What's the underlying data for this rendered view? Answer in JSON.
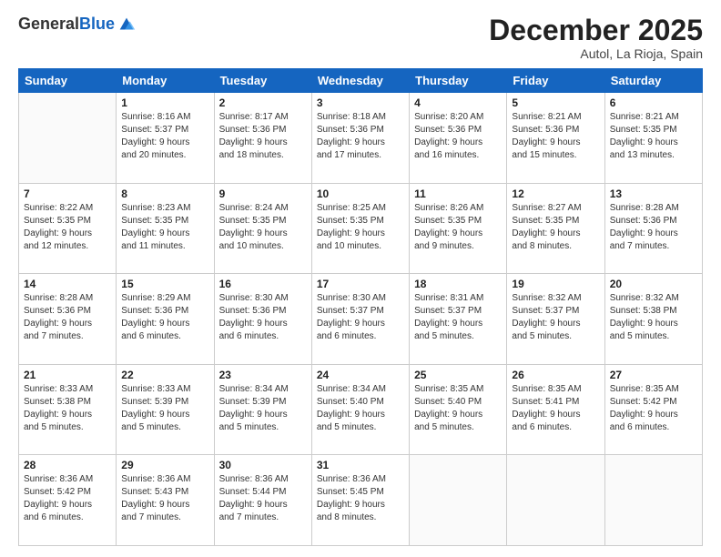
{
  "logo": {
    "general": "General",
    "blue": "Blue"
  },
  "header": {
    "month": "December 2025",
    "location": "Autol, La Rioja, Spain"
  },
  "weekdays": [
    "Sunday",
    "Monday",
    "Tuesday",
    "Wednesday",
    "Thursday",
    "Friday",
    "Saturday"
  ],
  "weeks": [
    [
      {
        "day": "",
        "info": ""
      },
      {
        "day": "1",
        "info": "Sunrise: 8:16 AM\nSunset: 5:37 PM\nDaylight: 9 hours\nand 20 minutes."
      },
      {
        "day": "2",
        "info": "Sunrise: 8:17 AM\nSunset: 5:36 PM\nDaylight: 9 hours\nand 18 minutes."
      },
      {
        "day": "3",
        "info": "Sunrise: 8:18 AM\nSunset: 5:36 PM\nDaylight: 9 hours\nand 17 minutes."
      },
      {
        "day": "4",
        "info": "Sunrise: 8:20 AM\nSunset: 5:36 PM\nDaylight: 9 hours\nand 16 minutes."
      },
      {
        "day": "5",
        "info": "Sunrise: 8:21 AM\nSunset: 5:36 PM\nDaylight: 9 hours\nand 15 minutes."
      },
      {
        "day": "6",
        "info": "Sunrise: 8:21 AM\nSunset: 5:35 PM\nDaylight: 9 hours\nand 13 minutes."
      }
    ],
    [
      {
        "day": "7",
        "info": "Sunrise: 8:22 AM\nSunset: 5:35 PM\nDaylight: 9 hours\nand 12 minutes."
      },
      {
        "day": "8",
        "info": "Sunrise: 8:23 AM\nSunset: 5:35 PM\nDaylight: 9 hours\nand 11 minutes."
      },
      {
        "day": "9",
        "info": "Sunrise: 8:24 AM\nSunset: 5:35 PM\nDaylight: 9 hours\nand 10 minutes."
      },
      {
        "day": "10",
        "info": "Sunrise: 8:25 AM\nSunset: 5:35 PM\nDaylight: 9 hours\nand 10 minutes."
      },
      {
        "day": "11",
        "info": "Sunrise: 8:26 AM\nSunset: 5:35 PM\nDaylight: 9 hours\nand 9 minutes."
      },
      {
        "day": "12",
        "info": "Sunrise: 8:27 AM\nSunset: 5:35 PM\nDaylight: 9 hours\nand 8 minutes."
      },
      {
        "day": "13",
        "info": "Sunrise: 8:28 AM\nSunset: 5:36 PM\nDaylight: 9 hours\nand 7 minutes."
      }
    ],
    [
      {
        "day": "14",
        "info": "Sunrise: 8:28 AM\nSunset: 5:36 PM\nDaylight: 9 hours\nand 7 minutes."
      },
      {
        "day": "15",
        "info": "Sunrise: 8:29 AM\nSunset: 5:36 PM\nDaylight: 9 hours\nand 6 minutes."
      },
      {
        "day": "16",
        "info": "Sunrise: 8:30 AM\nSunset: 5:36 PM\nDaylight: 9 hours\nand 6 minutes."
      },
      {
        "day": "17",
        "info": "Sunrise: 8:30 AM\nSunset: 5:37 PM\nDaylight: 9 hours\nand 6 minutes."
      },
      {
        "day": "18",
        "info": "Sunrise: 8:31 AM\nSunset: 5:37 PM\nDaylight: 9 hours\nand 5 minutes."
      },
      {
        "day": "19",
        "info": "Sunrise: 8:32 AM\nSunset: 5:37 PM\nDaylight: 9 hours\nand 5 minutes."
      },
      {
        "day": "20",
        "info": "Sunrise: 8:32 AM\nSunset: 5:38 PM\nDaylight: 9 hours\nand 5 minutes."
      }
    ],
    [
      {
        "day": "21",
        "info": "Sunrise: 8:33 AM\nSunset: 5:38 PM\nDaylight: 9 hours\nand 5 minutes."
      },
      {
        "day": "22",
        "info": "Sunrise: 8:33 AM\nSunset: 5:39 PM\nDaylight: 9 hours\nand 5 minutes."
      },
      {
        "day": "23",
        "info": "Sunrise: 8:34 AM\nSunset: 5:39 PM\nDaylight: 9 hours\nand 5 minutes."
      },
      {
        "day": "24",
        "info": "Sunrise: 8:34 AM\nSunset: 5:40 PM\nDaylight: 9 hours\nand 5 minutes."
      },
      {
        "day": "25",
        "info": "Sunrise: 8:35 AM\nSunset: 5:40 PM\nDaylight: 9 hours\nand 5 minutes."
      },
      {
        "day": "26",
        "info": "Sunrise: 8:35 AM\nSunset: 5:41 PM\nDaylight: 9 hours\nand 6 minutes."
      },
      {
        "day": "27",
        "info": "Sunrise: 8:35 AM\nSunset: 5:42 PM\nDaylight: 9 hours\nand 6 minutes."
      }
    ],
    [
      {
        "day": "28",
        "info": "Sunrise: 8:36 AM\nSunset: 5:42 PM\nDaylight: 9 hours\nand 6 minutes."
      },
      {
        "day": "29",
        "info": "Sunrise: 8:36 AM\nSunset: 5:43 PM\nDaylight: 9 hours\nand 7 minutes."
      },
      {
        "day": "30",
        "info": "Sunrise: 8:36 AM\nSunset: 5:44 PM\nDaylight: 9 hours\nand 7 minutes."
      },
      {
        "day": "31",
        "info": "Sunrise: 8:36 AM\nSunset: 5:45 PM\nDaylight: 9 hours\nand 8 minutes."
      },
      {
        "day": "",
        "info": ""
      },
      {
        "day": "",
        "info": ""
      },
      {
        "day": "",
        "info": ""
      }
    ]
  ]
}
